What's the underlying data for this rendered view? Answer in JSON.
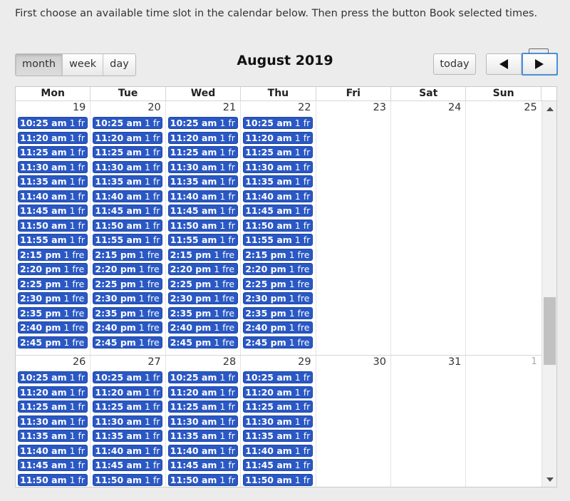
{
  "instructions": "First choose an available time slot in the calendar below. Then press the button Book selected times.",
  "toolbar": {
    "views": [
      "month",
      "week",
      "day"
    ],
    "active_view": "month",
    "title": "August 2019",
    "today_label": "today"
  },
  "weekdays": [
    "Mon",
    "Tue",
    "Wed",
    "Thu",
    "Fri",
    "Sat",
    "Sun"
  ],
  "weeks": [
    {
      "days": [
        "19",
        "20",
        "21",
        "22",
        "23",
        "24",
        "25"
      ],
      "other_month": [
        false,
        false,
        false,
        false,
        false,
        false,
        false
      ]
    },
    {
      "days": [
        "26",
        "27",
        "28",
        "29",
        "30",
        "31",
        "1"
      ],
      "other_month": [
        false,
        false,
        false,
        false,
        false,
        false,
        true
      ]
    }
  ],
  "week1_slots": [
    {
      "time": "10:25 am",
      "free": "1 fr"
    },
    {
      "time": "11:20 am",
      "free": "1 fr"
    },
    {
      "time": "11:25 am",
      "free": "1 fr"
    },
    {
      "time": "11:30 am",
      "free": "1 fr"
    },
    {
      "time": "11:35 am",
      "free": "1 fr"
    },
    {
      "time": "11:40 am",
      "free": "1 fr"
    },
    {
      "time": "11:45 am",
      "free": "1 fr"
    },
    {
      "time": "11:50 am",
      "free": "1 fr"
    },
    {
      "time": "11:55 am",
      "free": "1 fr"
    },
    {
      "time": "2:15 pm",
      "free": "1 fre"
    },
    {
      "time": "2:20 pm",
      "free": "1 fre"
    },
    {
      "time": "2:25 pm",
      "free": "1 fre"
    },
    {
      "time": "2:30 pm",
      "free": "1 fre"
    },
    {
      "time": "2:35 pm",
      "free": "1 fre"
    },
    {
      "time": "2:40 pm",
      "free": "1 fre"
    },
    {
      "time": "2:45 pm",
      "free": "1 fre"
    }
  ],
  "week2_slots": [
    {
      "time": "10:25 am",
      "free": "1 fr"
    },
    {
      "time": "11:20 am",
      "free": "1 fr"
    },
    {
      "time": "11:25 am",
      "free": "1 fr"
    },
    {
      "time": "11:30 am",
      "free": "1 fr"
    },
    {
      "time": "11:35 am",
      "free": "1 fr"
    },
    {
      "time": "11:40 am",
      "free": "1 fr"
    },
    {
      "time": "11:45 am",
      "free": "1 fr"
    },
    {
      "time": "11:50 am",
      "free": "1 fr"
    }
  ],
  "colors": {
    "event_bg": "#2a58c4",
    "event_border": "#1d45a8",
    "focus_ring": "#4a90d9"
  },
  "icons": {
    "prev": "triangle-left-icon",
    "next": "triangle-right-icon"
  }
}
